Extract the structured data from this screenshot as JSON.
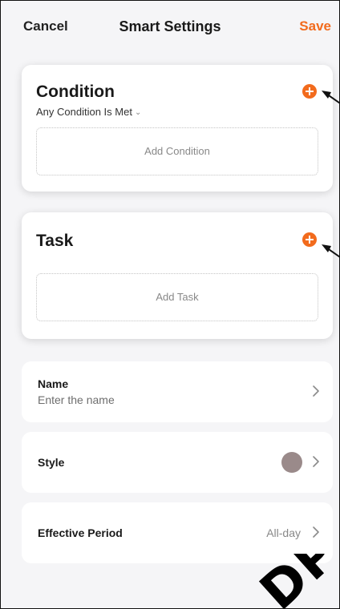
{
  "header": {
    "cancel_label": "Cancel",
    "title": "Smart Settings",
    "save_label": "Save"
  },
  "condition_card": {
    "title": "Condition",
    "subtitle": "Any Condition Is Met",
    "dropdown_icon": "chevron-down-icon",
    "add_icon": "plus-circle-icon",
    "add_label": "Add Condition"
  },
  "task_card": {
    "title": "Task",
    "add_icon": "plus-circle-icon",
    "add_label": "Add Task"
  },
  "name_row": {
    "label": "Name",
    "placeholder": "Enter the name",
    "icon": "chevron-right-icon"
  },
  "style_row": {
    "label": "Style",
    "color": "#9a8a8a",
    "icon": "chevron-right-icon"
  },
  "period_row": {
    "label": "Effective Period",
    "value": "All-day",
    "icon": "chevron-right-icon"
  },
  "colors": {
    "accent": "#f26b1d",
    "background": "#f5f5f7",
    "card": "#ffffff"
  }
}
